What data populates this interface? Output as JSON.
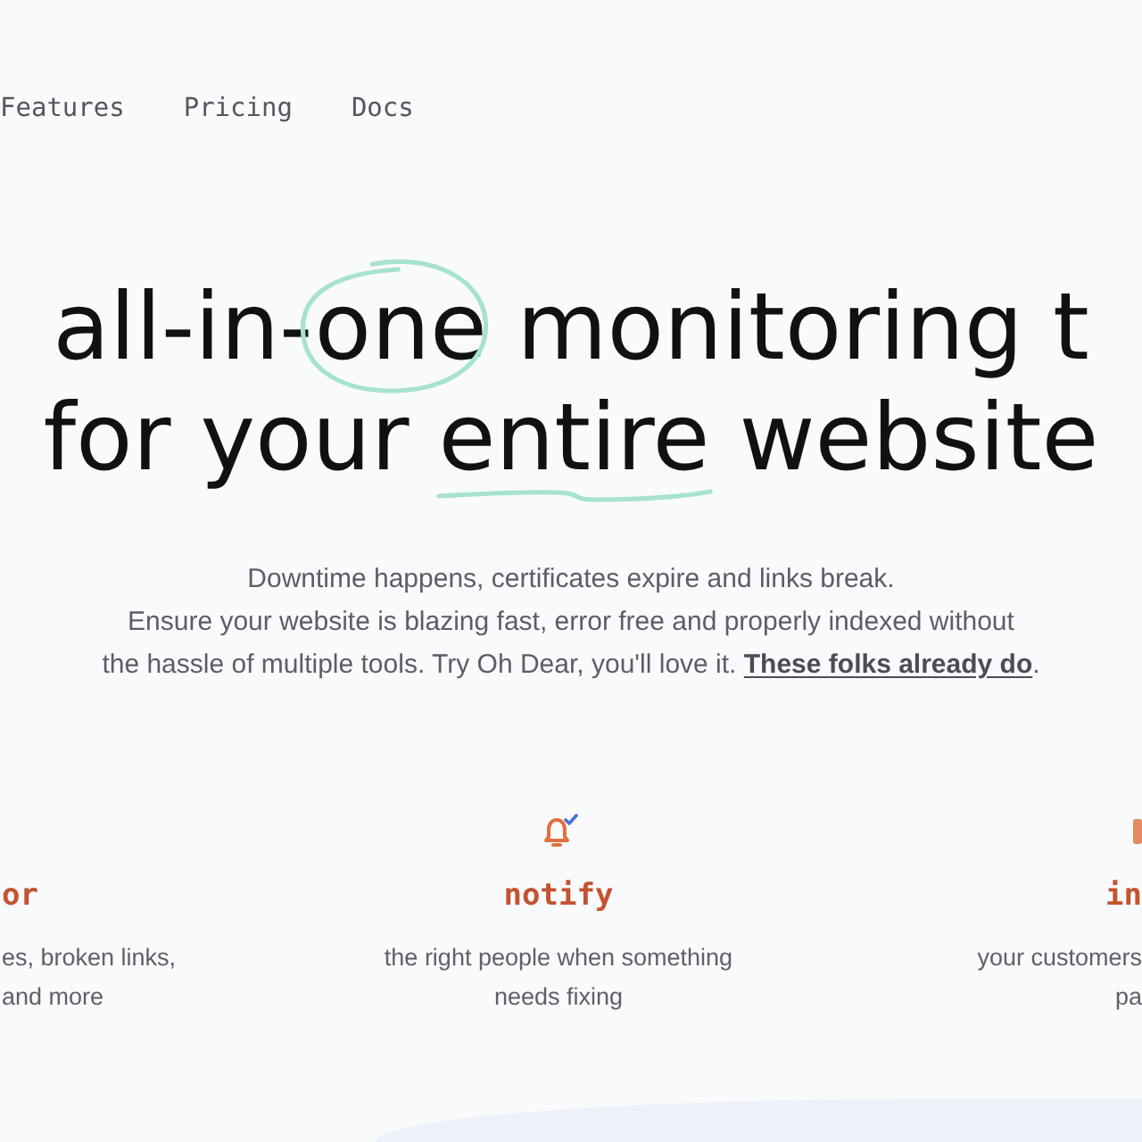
{
  "nav": {
    "links": [
      {
        "label": "Features"
      },
      {
        "label": "Pricing"
      },
      {
        "label": "Docs"
      }
    ]
  },
  "headline": {
    "lines": [
      {
        "segments": [
          {
            "text": "all-in-",
            "kind": "plain"
          },
          {
            "text": "one",
            "kind": "circled"
          },
          {
            "text": " monitoring t",
            "kind": "plain"
          }
        ]
      },
      {
        "segments": [
          {
            "text": "for your ",
            "kind": "plain"
          },
          {
            "text": "entire",
            "kind": "underlined"
          },
          {
            "text": " website",
            "kind": "plain"
          }
        ]
      }
    ]
  },
  "intro": {
    "lines": [
      "Downtime happens, certificates expire and links break.",
      "Ensure your website is blazing fast, error free and properly indexed without",
      "the hassle of multiple tools. Try Oh Dear, you'll love it."
    ],
    "link": "These folks already do",
    "end": "."
  },
  "features": [
    {
      "title": "or",
      "description": [
        "es, broken links,",
        "and more"
      ]
    },
    {
      "title": "notify",
      "description": [
        "the right people when something",
        "needs fixing"
      ]
    },
    {
      "title": "in",
      "description": [
        "your customers",
        "pa"
      ]
    }
  ]
}
